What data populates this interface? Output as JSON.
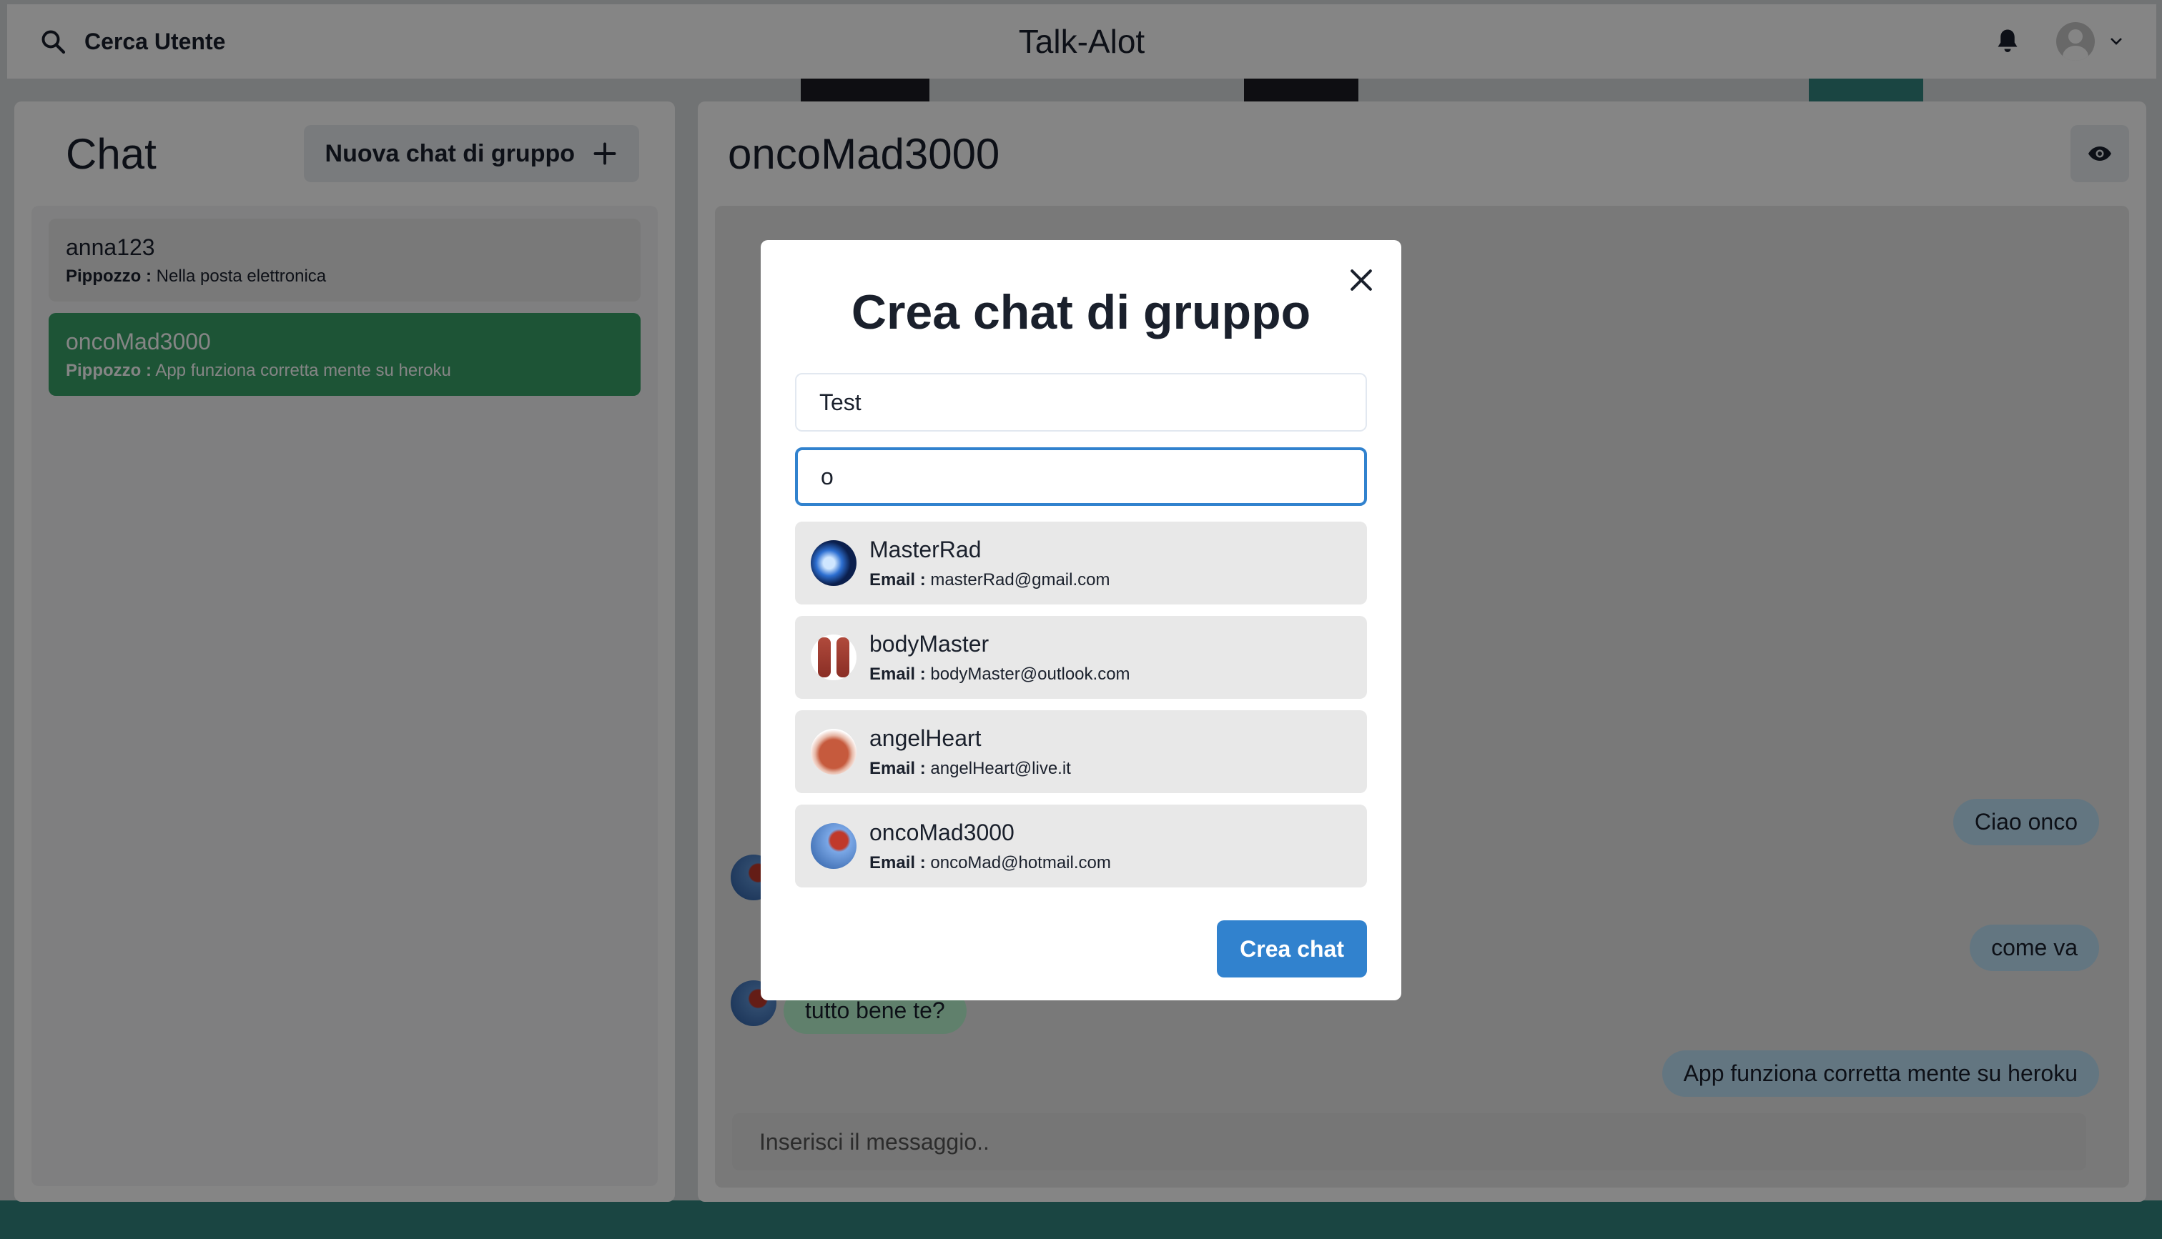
{
  "topbar": {
    "search_label": "Cerca Utente",
    "app_title": "Talk-Alot"
  },
  "sidebar": {
    "title": "Chat",
    "new_group_label": "Nuova chat di gruppo",
    "chats": [
      {
        "name": "anna123",
        "sender": "Pippozzo :",
        "last_message": "Nella posta elettronica",
        "active": false
      },
      {
        "name": "oncoMad3000",
        "sender": "Pippozzo :",
        "last_message": "App funziona corretta mente su heroku",
        "active": true
      }
    ]
  },
  "conversation": {
    "title": "oncoMad3000",
    "messages": [
      {
        "text": "Ciao onco",
        "mine": true
      },
      {
        "text": "come va",
        "mine": true
      },
      {
        "text": "tutto bene te?",
        "mine": false
      },
      {
        "text": "App funziona corretta mente su heroku",
        "mine": true
      }
    ],
    "input_placeholder": "Inserisci il messaggio.."
  },
  "modal": {
    "title": "Crea chat di gruppo",
    "chat_name_value": "Test",
    "search_value": "o",
    "email_label": "Email :",
    "users": [
      {
        "name": "MasterRad",
        "email": "masterRad@gmail.com"
      },
      {
        "name": "bodyMaster",
        "email": "bodyMaster@outlook.com"
      },
      {
        "name": "angelHeart",
        "email": "angelHeart@live.it"
      },
      {
        "name": "oncoMad3000",
        "email": "oncoMad@hotmail.com"
      }
    ],
    "submit_label": "Crea chat"
  },
  "colors": {
    "accent": "#3182ce",
    "active_chat": "#38a169",
    "my_bubble": "#bee3f8",
    "their_bubble": "#b9f5d0"
  }
}
